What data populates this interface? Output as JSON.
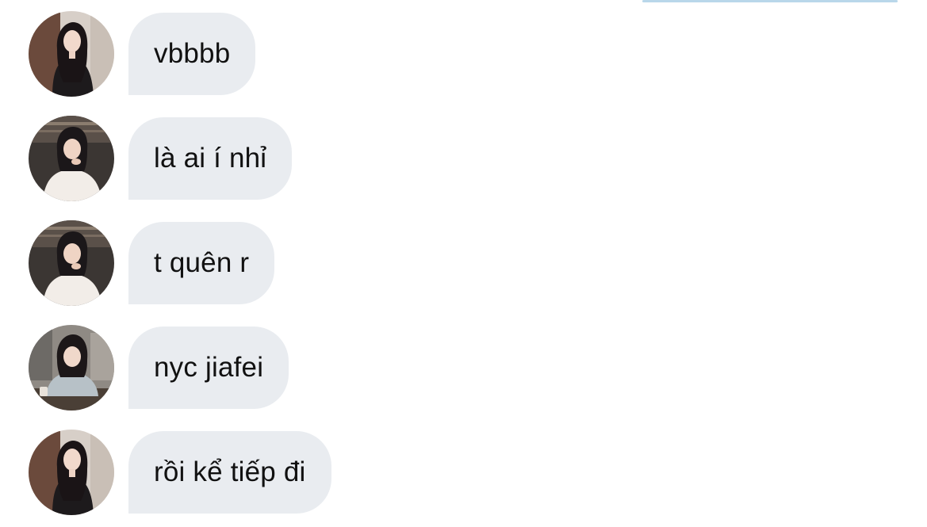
{
  "colors": {
    "bubble_background": "#e9ecf0",
    "text": "#111111",
    "top_accent": "#b9d7ea",
    "background": "#ffffff"
  },
  "messages": [
    {
      "text": "vbbbb",
      "avatar": "avatar-dark-outfit"
    },
    {
      "text": "là ai í nhỉ",
      "avatar": "avatar-white-top"
    },
    {
      "text": "t quên r",
      "avatar": "avatar-white-top"
    },
    {
      "text": "nyc jiafei",
      "avatar": "avatar-cafe"
    },
    {
      "text": "rồi kể tiếp đi",
      "avatar": "avatar-dark-outfit"
    }
  ]
}
